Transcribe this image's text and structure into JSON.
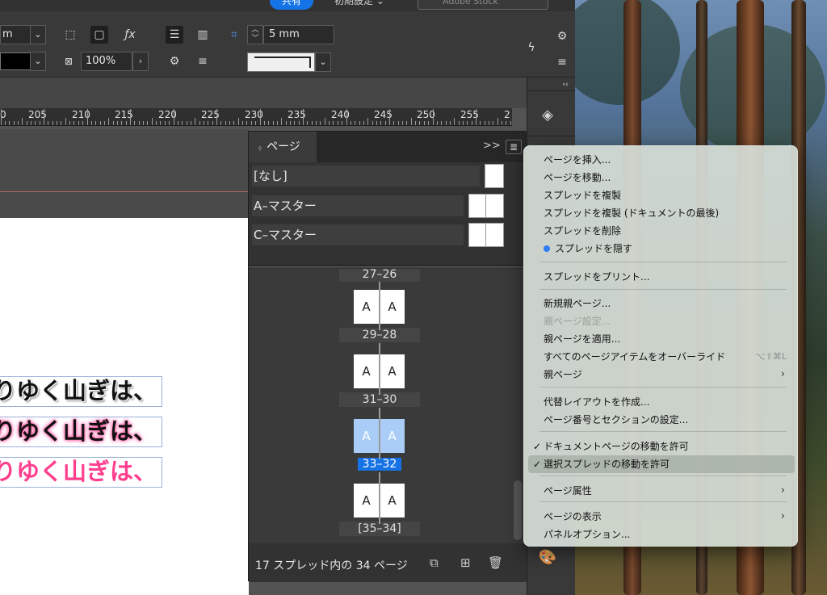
{
  "topbar": {
    "share_label": "共有",
    "workspace_label": "初期設定",
    "stock_placeholder": "Adobe Stock"
  },
  "controlbar": {
    "unit_field": "m",
    "opacity": "100%",
    "gap_field": "5 mm"
  },
  "ruler": {
    "labels": [
      "0",
      "205",
      "210",
      "215",
      "220",
      "225",
      "230",
      "235",
      "240",
      "245",
      "250",
      "255",
      "2"
    ]
  },
  "document": {
    "lines": [
      "りゆく山ぎは、",
      "りゆく山ぎは、",
      "りゆく山ぎは、"
    ]
  },
  "pages_panel": {
    "tab_label": "ページ",
    "masters": [
      "[なし]",
      "A–マスター",
      "C–マスター"
    ],
    "spreads": [
      {
        "label": "27–26",
        "left": "",
        "right": "",
        "selected": false
      },
      {
        "label": "29–28",
        "left": "A",
        "right": "A",
        "selected": false
      },
      {
        "label": "31–30",
        "left": "A",
        "right": "A",
        "selected": false
      },
      {
        "label": "33–32",
        "left": "A",
        "right": "A",
        "selected": true
      },
      {
        "label": "[35–34]",
        "left": "A",
        "right": "A",
        "selected": false
      }
    ],
    "footer_text": "17 スプレッド内の 34 ページ"
  },
  "menu": {
    "items": [
      {
        "label": "ページを挿入...",
        "state": "normal"
      },
      {
        "label": "ページを移動...",
        "state": "normal"
      },
      {
        "label": "スプレッドを複製",
        "state": "normal"
      },
      {
        "label": "スプレッドを複製 (ドキュメントの最後)",
        "state": "normal"
      },
      {
        "label": "スプレッドを削除",
        "state": "normal"
      },
      {
        "label": "スプレッドを隠す",
        "state": "dot"
      },
      {
        "label": "スプレッドをプリント...",
        "state": "normal"
      },
      {
        "label": "新規親ページ...",
        "state": "normal"
      },
      {
        "label": "親ページ設定...",
        "state": "disabled"
      },
      {
        "label": "親ページを適用...",
        "state": "normal"
      },
      {
        "label": "すべてのページアイテムをオーバーライド",
        "state": "normal",
        "shortcut": "⌥⇧⌘L"
      },
      {
        "label": "親ページ",
        "state": "submenu"
      },
      {
        "label": "代替レイアウトを作成...",
        "state": "normal"
      },
      {
        "label": "ページ番号とセクションの設定...",
        "state": "normal"
      },
      {
        "label": "ドキュメントページの移動を許可",
        "state": "checked"
      },
      {
        "label": "選択スプレッドの移動を許可",
        "state": "checked-highlight"
      },
      {
        "label": "ページ属性",
        "state": "submenu"
      },
      {
        "label": "ページの表示",
        "state": "submenu"
      },
      {
        "label": "パネルオプション...",
        "state": "normal"
      }
    ]
  },
  "colors": {
    "accent": "#1673e6",
    "selection_page": "#a9cdf7",
    "menu_dot": "#2f7cf6"
  }
}
